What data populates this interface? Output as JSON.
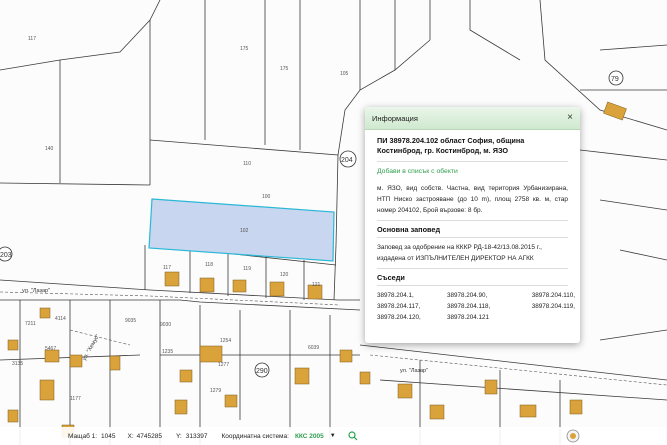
{
  "map": {
    "parcel_labels": [
      "117",
      "140",
      "175",
      "175",
      "105",
      "110",
      "102",
      "100",
      "117",
      "118",
      "119",
      "120",
      "121",
      "9035",
      "9030",
      "1235",
      "1254",
      "1277",
      "1279",
      "6039",
      "7211",
      "4114",
      "5467",
      "3135",
      "1177"
    ],
    "circle_labels": [
      "79",
      "204",
      "203",
      "290"
    ],
    "street_labels": [
      "ул. \"Лазар\"",
      "ул. \"Хемус\"",
      "ул. \"Лазар\""
    ]
  },
  "info": {
    "title": "Информация",
    "close": "×",
    "heading": "ПИ 38978.204.102 област София, община Костинброд, гр. Костинброд, м. ЯЗО",
    "add_link": "Добави в списък с обекти",
    "description": "м. ЯЗО, вид собств. Частна, вид територия Урбанизирана, НТП Ниско застрояване (до 10 m), площ 2758 кв. м, стар номер 204102, Брой вързове: 8 бр.",
    "order_title": "Основна заповед",
    "order_text": "Заповед за одобрение на КККР РД-18-42/13.08.2015 г., издадена от ИЗПЪЛНИТЕЛЕН ДИРЕКТОР НА АГКК",
    "neighbors_title": "Съседи",
    "neighbors": [
      "38978.204.1,",
      "38978.204.90,",
      "38978.204.110,",
      "38978.204.117,",
      "38978.204.118,",
      "38978.204.119,",
      "38978.204.120,",
      "38978.204.121",
      ""
    ]
  },
  "status": {
    "scale_label": "Мащаб 1:",
    "scale_value": "1045",
    "x_label": "X:",
    "x_value": "4745285",
    "y_label": "Y:",
    "y_value": "313397",
    "crs_label": "Координатна система:",
    "crs_value": "ККС 2005",
    "caret": "▼"
  },
  "colors": {
    "building": "#d9a23a",
    "selected_fill": "#c9d6ef",
    "selected_stroke": "#2ab8d6",
    "accent": "#2e9e4d"
  }
}
